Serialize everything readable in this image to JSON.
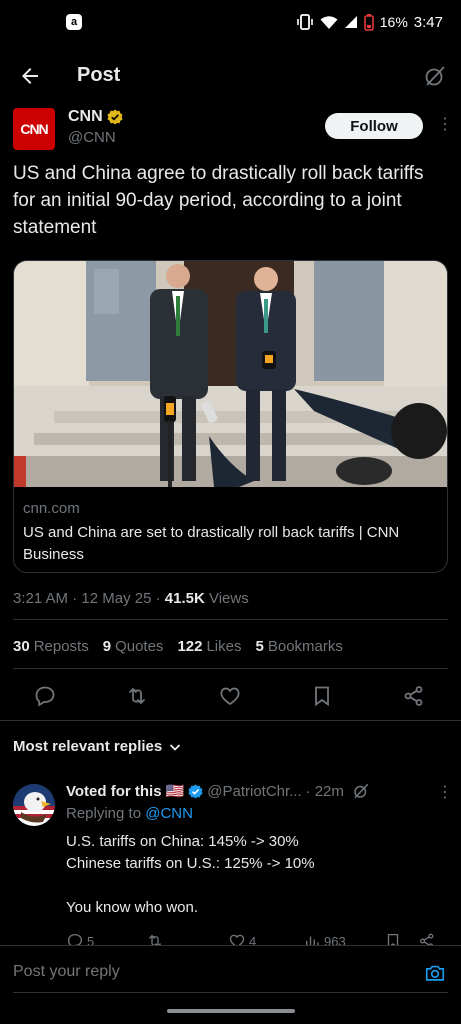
{
  "status_bar": {
    "app_badge": "a",
    "battery": "16%",
    "time": "3:47"
  },
  "header": {
    "title": "Post"
  },
  "tweet": {
    "author_name": "CNN",
    "author_handle": "@CNN",
    "avatar_text": "CNN",
    "follow_label": "Follow",
    "text": "US and China agree to drastically roll back tariffs for an initial 90-day period, according to a joint statement",
    "card": {
      "domain": "cnn.com",
      "title": "US and China are set to drastically roll back tariffs | CNN Business"
    },
    "meta": {
      "time": "3:21 AM",
      "date": "12 May 25",
      "views_count": "41.5K",
      "views_label": "Views"
    },
    "stats": [
      {
        "count": "30",
        "label": "Reposts"
      },
      {
        "count": "9",
        "label": "Quotes"
      },
      {
        "count": "122",
        "label": "Likes"
      },
      {
        "count": "5",
        "label": "Bookmarks"
      }
    ]
  },
  "replies": {
    "sort_label": "Most relevant replies",
    "items": [
      {
        "name": "Voted for this",
        "flag": "🇺🇸",
        "handle": "@PatriotChr...",
        "time": "22m",
        "replying_prefix": "Replying to",
        "replying_to": "@CNN",
        "text": "U.S. tariffs on China: 145% -> 30%\nChinese tariffs on U.S.: 125% -> 10%\n\nYou know who won.",
        "counts": {
          "replies": "5",
          "likes": "4",
          "views": "963"
        }
      }
    ]
  },
  "compose": {
    "placeholder": "Post your reply"
  },
  "colors": {
    "accent": "#1d9bf0",
    "gold_badge": "#e2b719",
    "background": "#000000",
    "muted": "#71767b"
  }
}
